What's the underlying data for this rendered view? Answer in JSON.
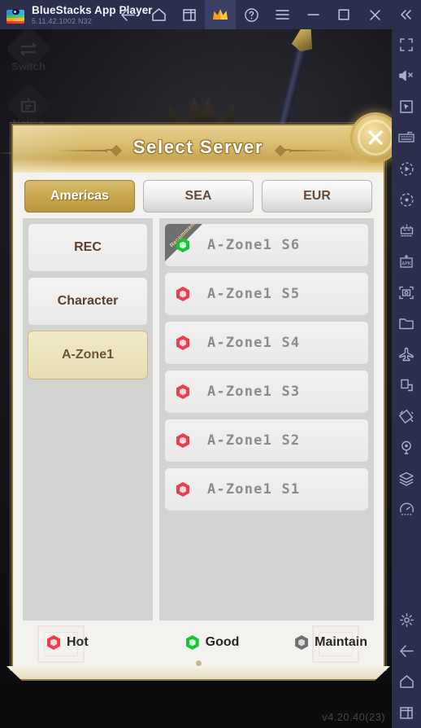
{
  "titlebar": {
    "app_name": "BlueStacks App Player",
    "version_line": "5.11.42.1002  N32",
    "logo_icon": "bluestacks-logo",
    "actions": [
      {
        "name": "back-button",
        "icon": "arrow-left-icon",
        "label": ""
      },
      {
        "name": "home-button",
        "icon": "home-icon",
        "label": ""
      },
      {
        "name": "multi-instance-button",
        "icon": "windows-stack-icon",
        "label": ""
      },
      {
        "name": "premium-button",
        "icon": "crown-icon",
        "label": "",
        "active": true
      },
      {
        "name": "help-button",
        "icon": "question-circle-icon",
        "label": ""
      },
      {
        "name": "menu-button",
        "icon": "hamburger-menu-icon",
        "label": ""
      },
      {
        "name": "minimize-button",
        "icon": "minimize-icon",
        "label": ""
      },
      {
        "name": "maximize-button",
        "icon": "maximize-square-icon",
        "label": ""
      },
      {
        "name": "close-window-button",
        "icon": "close-x-icon",
        "label": ""
      },
      {
        "name": "collapse-sidebar-button",
        "icon": "double-chevron-left-icon",
        "label": ""
      }
    ]
  },
  "sidebar": {
    "items_top": [
      {
        "name": "fullscreen-button",
        "icon": "fullscreen-corners-icon"
      },
      {
        "name": "mute-button",
        "icon": "speaker-mute-icon"
      },
      {
        "name": "cursor-pointer-button",
        "icon": "cursor-arrow-box-icon"
      },
      {
        "name": "keyboard-controls-button",
        "icon": "keyboard-icon"
      },
      {
        "name": "macro-recorder-button",
        "icon": "play-dashed-circle-icon"
      },
      {
        "name": "script-button",
        "icon": "dot-circle-dashed-icon"
      },
      {
        "name": "multi-instance-sync-button",
        "icon": "sync-grid-icon"
      },
      {
        "name": "install-apk-button",
        "icon": "apk-plus-icon"
      },
      {
        "name": "screenshot-button",
        "icon": "camera-frame-icon"
      },
      {
        "name": "media-manager-button",
        "icon": "folder-icon"
      },
      {
        "name": "eco-mode-button",
        "icon": "airplane-icon"
      },
      {
        "name": "pip-button",
        "icon": "picture-in-picture-icon"
      },
      {
        "name": "rotate-button",
        "icon": "rotate-device-icon"
      },
      {
        "name": "location-button",
        "icon": "location-pin-icon"
      },
      {
        "name": "layers-button",
        "icon": "layers-icon"
      },
      {
        "name": "performance-button",
        "icon": "speedometer-icon"
      }
    ],
    "items_bottom": [
      {
        "name": "settings-button",
        "icon": "gear-icon"
      },
      {
        "name": "android-back-button",
        "icon": "arrow-left-icon"
      },
      {
        "name": "android-home-button",
        "icon": "home-icon"
      },
      {
        "name": "android-recents-button",
        "icon": "recents-icon"
      }
    ]
  },
  "game": {
    "left_nav": [
      {
        "name": "switch-nav",
        "label": "Switch",
        "icon": "switch-arrows-icon"
      },
      {
        "name": "notice-nav",
        "label": "Notice",
        "icon": "notice-board-icon"
      }
    ],
    "app_version": "v4.20.40(23)"
  },
  "dialog": {
    "title": "Select Server",
    "close_icon": "close-x-icon",
    "region_tabs": [
      {
        "label": "Americas",
        "selected": true
      },
      {
        "label": "SEA",
        "selected": false
      },
      {
        "label": "EUR",
        "selected": false
      }
    ],
    "zone_list": [
      {
        "label": "REC",
        "selected": false
      },
      {
        "label": "Character",
        "selected": false
      },
      {
        "label": "A-Zone1",
        "selected": true
      }
    ],
    "servers": [
      {
        "name": "A-Zone1  S6",
        "status": "good",
        "ribbon": "Recommend"
      },
      {
        "name": "A-Zone1  S5",
        "status": "hot",
        "ribbon": ""
      },
      {
        "name": "A-Zone1  S4",
        "status": "hot",
        "ribbon": ""
      },
      {
        "name": "A-Zone1  S3",
        "status": "hot",
        "ribbon": ""
      },
      {
        "name": "A-Zone1  S2",
        "status": "hot",
        "ribbon": ""
      },
      {
        "name": "A-Zone1  S1",
        "status": "hot",
        "ribbon": ""
      }
    ],
    "legend": [
      {
        "label": "Hot",
        "status": "hot",
        "color": "#ef3b4e"
      },
      {
        "label": "Good",
        "status": "good",
        "color": "#16c436"
      },
      {
        "label": "Maintain",
        "status": "maintain",
        "color": "#6f6f6f"
      }
    ]
  }
}
